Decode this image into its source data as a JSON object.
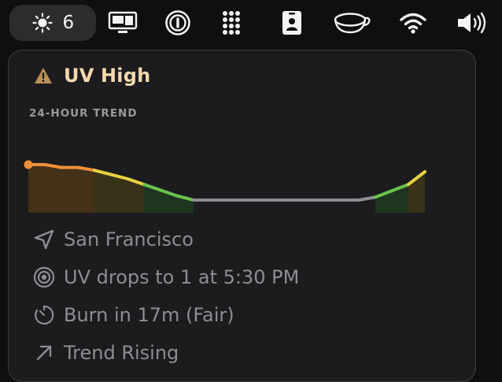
{
  "menubar": {
    "uv_index": "6",
    "items": [
      {
        "icon": "sun-icon"
      },
      {
        "icon": "display-icon"
      },
      {
        "icon": "password-manager-icon"
      },
      {
        "icon": "grid-dots-icon"
      },
      {
        "icon": "id-badge-icon"
      },
      {
        "icon": "cup-icon"
      },
      {
        "icon": "wifi-icon"
      },
      {
        "icon": "volume-icon"
      }
    ]
  },
  "popover": {
    "title": "UV High",
    "title_icon": "warning-triangle-icon",
    "accent_color": "#f5d9ae",
    "trend_label": "24-HOUR TREND",
    "rows": [
      {
        "icon": "location-arrow-icon",
        "text": "San Francisco"
      },
      {
        "icon": "target-icon",
        "text": "UV drops to 1 at 5:30 PM"
      },
      {
        "icon": "timer-icon",
        "text": "Burn in 17m (Fair)"
      },
      {
        "icon": "trend-up-arrow-icon",
        "text": "Trend Rising"
      }
    ]
  },
  "chart_data": {
    "type": "area",
    "title": "",
    "xlabel": "",
    "ylabel": "",
    "x": [
      0,
      1,
      2,
      3,
      4,
      5,
      6,
      7,
      8,
      9,
      10,
      11,
      12,
      13,
      14,
      15,
      16,
      17,
      18,
      19,
      20,
      21,
      22,
      23,
      24
    ],
    "values": [
      6,
      6,
      5.6,
      5.6,
      5.2,
      4.6,
      4,
      3.2,
      2.4,
      1.6,
      1,
      1,
      1,
      1,
      1,
      1,
      1,
      1,
      1,
      1,
      1,
      1.4,
      2.3,
      3.2,
      5
    ],
    "current_index": 0,
    "segment_colors": {
      "high": "#f0903a",
      "moderate": "#e8d243",
      "low": "#6cc14e",
      "minimal": "#8e8e92"
    }
  }
}
